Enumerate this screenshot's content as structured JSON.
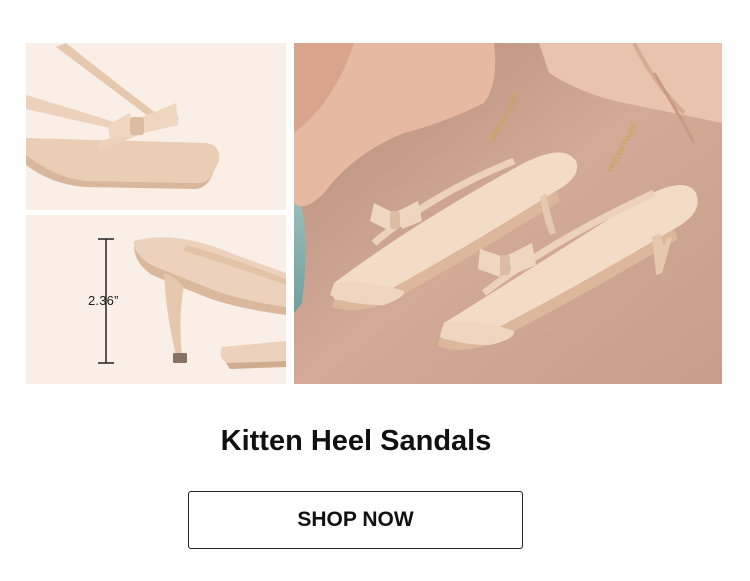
{
  "images": {
    "toe_detail": {
      "icon": "sandal-toe-closeup"
    },
    "heel_detail": {
      "icon": "sandal-heel-closeup",
      "heel_height": "2.36”"
    },
    "lifestyle": {
      "icon": "sandals-lifestyle-photo",
      "brand_stamp": "DREAM PAIRS"
    }
  },
  "product": {
    "title": "Kitten Heel Sandals"
  },
  "cta": {
    "label": "SHOP NOW"
  },
  "colors": {
    "nude": "#ecd2bc",
    "background": "#f9efe6",
    "text": "#111111"
  }
}
